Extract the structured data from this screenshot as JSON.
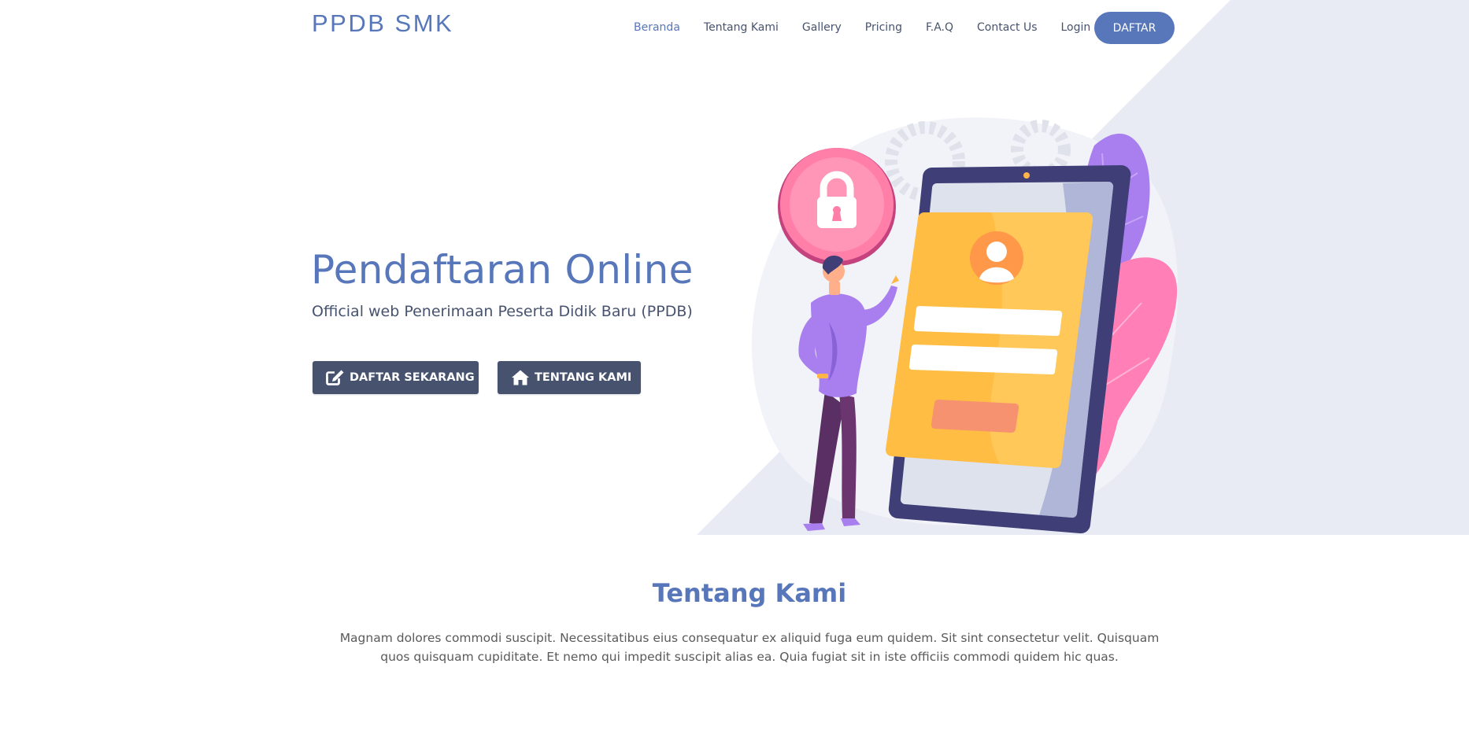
{
  "brand": {
    "logo": "PPDB SMK"
  },
  "nav": {
    "items": [
      {
        "label": "Beranda",
        "active": true
      },
      {
        "label": "Tentang Kami",
        "active": false
      },
      {
        "label": "Gallery",
        "active": false
      },
      {
        "label": "Pricing",
        "active": false
      },
      {
        "label": "F.A.Q",
        "active": false
      },
      {
        "label": "Contact Us",
        "active": false
      },
      {
        "label": "Login",
        "active": false
      }
    ],
    "cta_label": "DAFTAR"
  },
  "hero": {
    "title": "Pendaftaran Online",
    "subtitle": "Official web Penerimaan Peserta Didik Baru (PPDB)",
    "buttons": [
      {
        "label": "DAFTAR SEKARANG",
        "icon": "edit-icon"
      },
      {
        "label": "TENTANG KAMI",
        "icon": "home-icon"
      }
    ],
    "illustration": "person-registering-on-phone-illustration"
  },
  "about": {
    "title": "Tentang Kami",
    "text": "Magnam dolores commodi suscipit. Necessitatibus eius consequatur ex aliquid fuga eum quidem. Sit sint consectetur velit. Quisquam quos quisquam cupiditate. Et nemo qui impedit suscipit alias ea. Quia fugiat sit in iste officiis commodi quidem hic quas."
  },
  "colors": {
    "accent": "#5777ba",
    "button_dark": "#47536e",
    "hero_bg": "#e8ebf3"
  }
}
